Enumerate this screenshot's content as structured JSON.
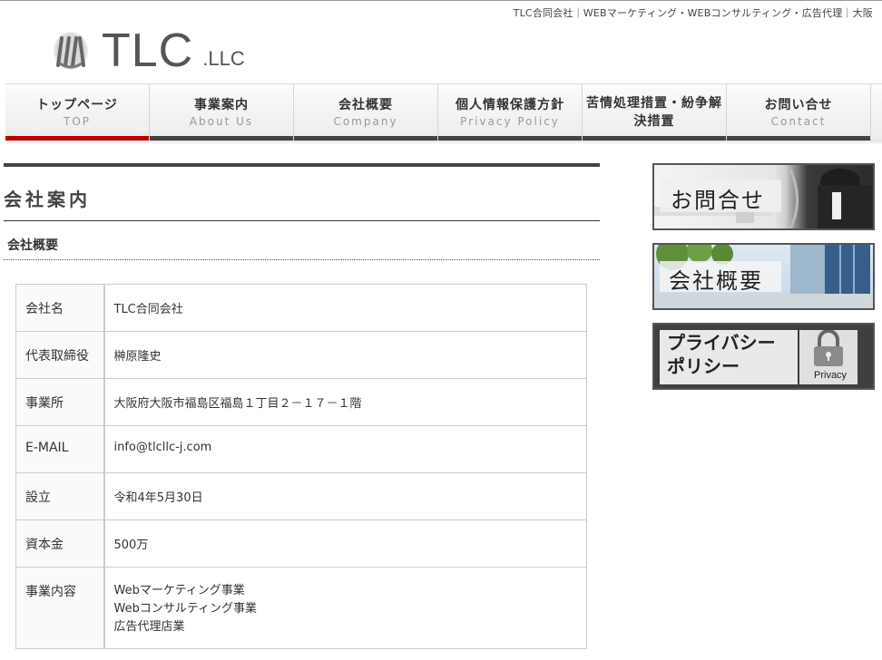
{
  "header": {
    "tagline": "TLC合同会社｜WEBマーケティング・WEBコンサルティング・広告代理｜大阪",
    "logo_text": "TLC",
    "logo_sub": ".LLC"
  },
  "nav": {
    "items": [
      {
        "jp": "トップページ",
        "en": "TOP",
        "active": true
      },
      {
        "jp": "事業案内",
        "en": "About Us"
      },
      {
        "jp": "会社概要",
        "en": "Company"
      },
      {
        "jp": "個人情報保護方針",
        "en": "Privacy Policy"
      },
      {
        "jp": "苦情処理措置・紛争解決措置",
        "en": ""
      },
      {
        "jp": "お問い合せ",
        "en": "Contact"
      }
    ]
  },
  "main": {
    "page_title": "会社案内",
    "subhead": "会社概要",
    "rows": [
      {
        "key": "会社名",
        "value": "TLC合同会社"
      },
      {
        "key": "代表取締役",
        "value": "榊原隆史"
      },
      {
        "key": "事業所",
        "value": "大阪府大阪市福島区福島１丁目２－１７－１階"
      },
      {
        "key": "E-MAIL",
        "value": "info@tlcllc-j.com"
      },
      {
        "key": "設立",
        "value": "令和4年5月30日"
      },
      {
        "key": "資本金",
        "value": "500万"
      },
      {
        "key": "事業内容",
        "lines": [
          "Webマーケティング事業",
          "Webコンサルティング事業",
          "広告代理店業"
        ]
      }
    ]
  },
  "sidebar": {
    "banners": [
      {
        "label": "お問合せ",
        "icon": "phone-icon"
      },
      {
        "label": "会社概要",
        "icon": "building-icon"
      },
      {
        "label_line1": "プライバシー",
        "label_line2": "ポリシー",
        "badge": "Privacy",
        "icon": "lock-icon"
      }
    ]
  },
  "colors": {
    "accent": "#c00000",
    "nav_bar": "#444444",
    "text": "#333333"
  }
}
